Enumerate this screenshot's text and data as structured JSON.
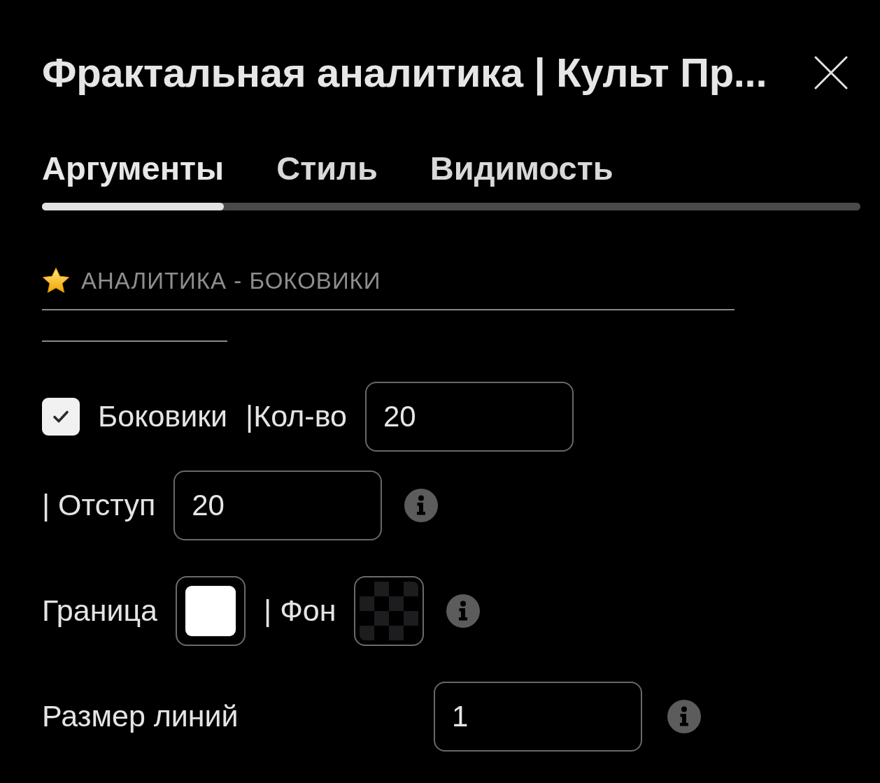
{
  "dialog": {
    "title": "Фрактальная аналитика | Культ Пр..."
  },
  "tabs": [
    {
      "label": "Аргументы",
      "selected": true
    },
    {
      "label": "Стиль",
      "selected": false
    },
    {
      "label": "Видимость",
      "selected": false
    }
  ],
  "section": {
    "title": "АНАЛИТИКА - БОКОВИКИ"
  },
  "rows": [
    {
      "kind": "inline",
      "items": [
        {
          "kind": "checkbox",
          "label": "Боковики",
          "checked": true
        },
        {
          "kind": "label",
          "text": "|Кол-во"
        },
        {
          "kind": "input",
          "value": "20"
        }
      ]
    },
    {
      "kind": "inline",
      "items": [
        {
          "kind": "label",
          "text": "| Отступ"
        },
        {
          "kind": "input",
          "value": "20"
        },
        {
          "kind": "info"
        }
      ]
    },
    {
      "kind": "inline",
      "items": [
        {
          "kind": "label",
          "text": "Граница"
        },
        {
          "kind": "swatch",
          "color": "#ffffff",
          "transparent": false
        },
        {
          "kind": "label",
          "text": "| Фон"
        },
        {
          "kind": "swatch",
          "transparent": true
        },
        {
          "kind": "info"
        }
      ]
    },
    {
      "kind": "labeled",
      "label": "Размер линий",
      "items": [
        {
          "kind": "input",
          "value": "1"
        },
        {
          "kind": "info"
        }
      ]
    }
  ]
}
